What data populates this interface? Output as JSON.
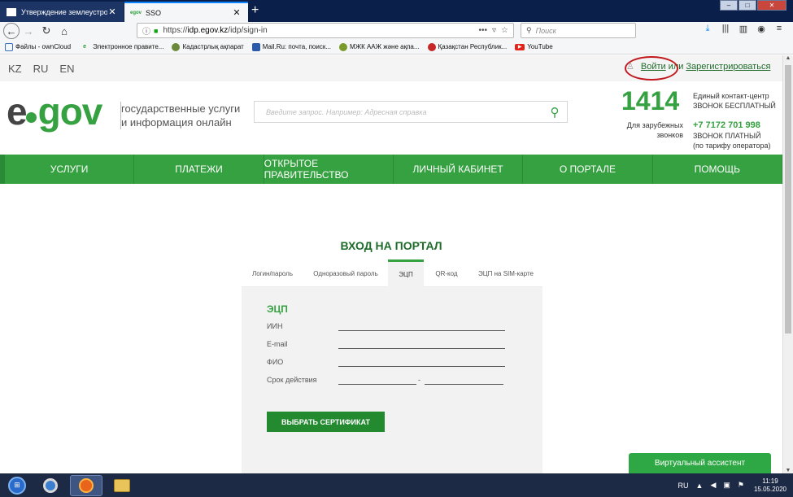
{
  "browser": {
    "tabs": [
      {
        "title": "Утверждение землеустроител",
        "favicon": "gov-favicon"
      },
      {
        "title": "SSO",
        "favicon": "egov-favicon",
        "favicon_text": "egov"
      }
    ],
    "new_tab_symbol": "+",
    "window_controls": {
      "minimize": "–",
      "maximize": "□",
      "close": "✕"
    },
    "url": {
      "scheme": "https://",
      "host": "idp.egov.kz",
      "path": "/idp/sign-in"
    },
    "page_actions": "•••",
    "search_placeholder": "Поиск",
    "bookmarks": [
      "Файлы - ownCloud",
      "Электронное правите...",
      "Кадастрлық ақпарат",
      "Mail.Ru: почта, поиск...",
      "МЖК ААЖ және ақпа...",
      "Қазақстан Республик...",
      "YouTube"
    ]
  },
  "site": {
    "languages": [
      "KZ",
      "RU",
      "EN"
    ],
    "login": {
      "signin": "Войти",
      "or": "или",
      "register": "Зарегистрироваться"
    },
    "logo": {
      "e": "e",
      "gov": "gov"
    },
    "tagline": [
      "государственные услуги",
      "и информация онлайн"
    ],
    "search_placeholder": "Введите запрос. Например: Адресная справка",
    "contact": {
      "short_number": "1414",
      "short_label": [
        "Единый контакт-центр",
        "ЗВОНОК БЕСПЛАТНЫЙ"
      ],
      "abroad": [
        "Для зарубежных",
        "звонков"
      ],
      "phone": "+7 7172 701 998",
      "phone_label": [
        "ЗВОНОК ПЛАТНЫЙ",
        "(по тарифу оператора)"
      ]
    },
    "nav": [
      "УСЛУГИ",
      "ПЛАТЕЖИ",
      "ОТКРЫТОЕ ПРАВИТЕЛЬСТВО",
      "ЛИЧНЫЙ КАБИНЕТ",
      "О ПОРТАЛЕ",
      "ПОМОЩЬ"
    ],
    "login_title": "ВХОД НА ПОРТАЛ",
    "login_tabs": [
      "Логин/пароль",
      "Одноразовый пароль",
      "ЭЦП",
      "QR-код",
      "ЭЦП на SIM-карте"
    ],
    "active_tab": "ЭЦП",
    "form": {
      "title": "ЭЦП",
      "fields": [
        "ИИН",
        "E-mail",
        "ФИО",
        "Срок действия"
      ],
      "range_separator": "-",
      "button": "ВЫБРАТЬ СЕРТИФИКАТ"
    },
    "assistant": "Виртуальный ассистент"
  },
  "taskbar": {
    "language": "RU",
    "time": "11:19",
    "date": "15.05.2020"
  },
  "colors": {
    "brand_green": "#35a141",
    "dark_green": "#1e6b2a",
    "button_green": "#238a30",
    "annotation_red": "#c2191f"
  }
}
